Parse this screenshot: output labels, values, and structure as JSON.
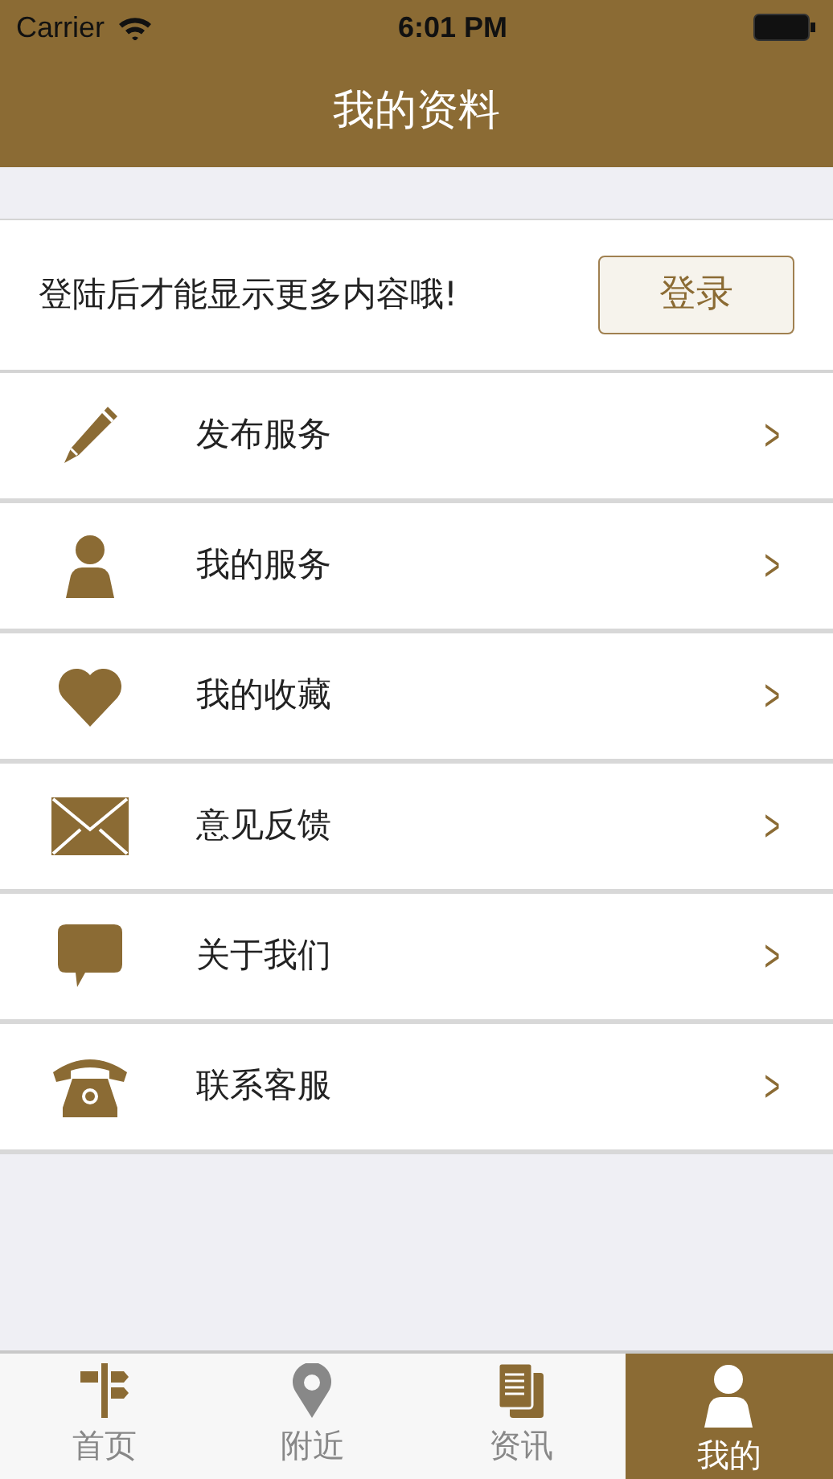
{
  "status_bar": {
    "carrier": "Carrier",
    "time": "6:01 PM"
  },
  "nav_title": "我的资料",
  "login": {
    "message": "登陆后才能显示更多内容哦!",
    "button": "登录"
  },
  "menu": [
    {
      "kind": "pencil",
      "label": "发布服务",
      "chevron": ">"
    },
    {
      "kind": "person",
      "label": "我的服务",
      "chevron": ">"
    },
    {
      "kind": "heart",
      "label": "我的收藏",
      "chevron": ">"
    },
    {
      "kind": "envelope",
      "label": "意见反馈",
      "chevron": ">"
    },
    {
      "kind": "speech",
      "label": "关于我们",
      "chevron": ">"
    },
    {
      "kind": "phone",
      "label": "联系客服",
      "chevron": ">"
    }
  ],
  "tabs": [
    {
      "kind": "signpost",
      "label": "首页",
      "selected": false
    },
    {
      "kind": "pin",
      "label": "附近",
      "selected": false
    },
    {
      "kind": "documents",
      "label": "资讯",
      "selected": false
    },
    {
      "kind": "person",
      "label": "我的",
      "selected": true
    }
  ]
}
